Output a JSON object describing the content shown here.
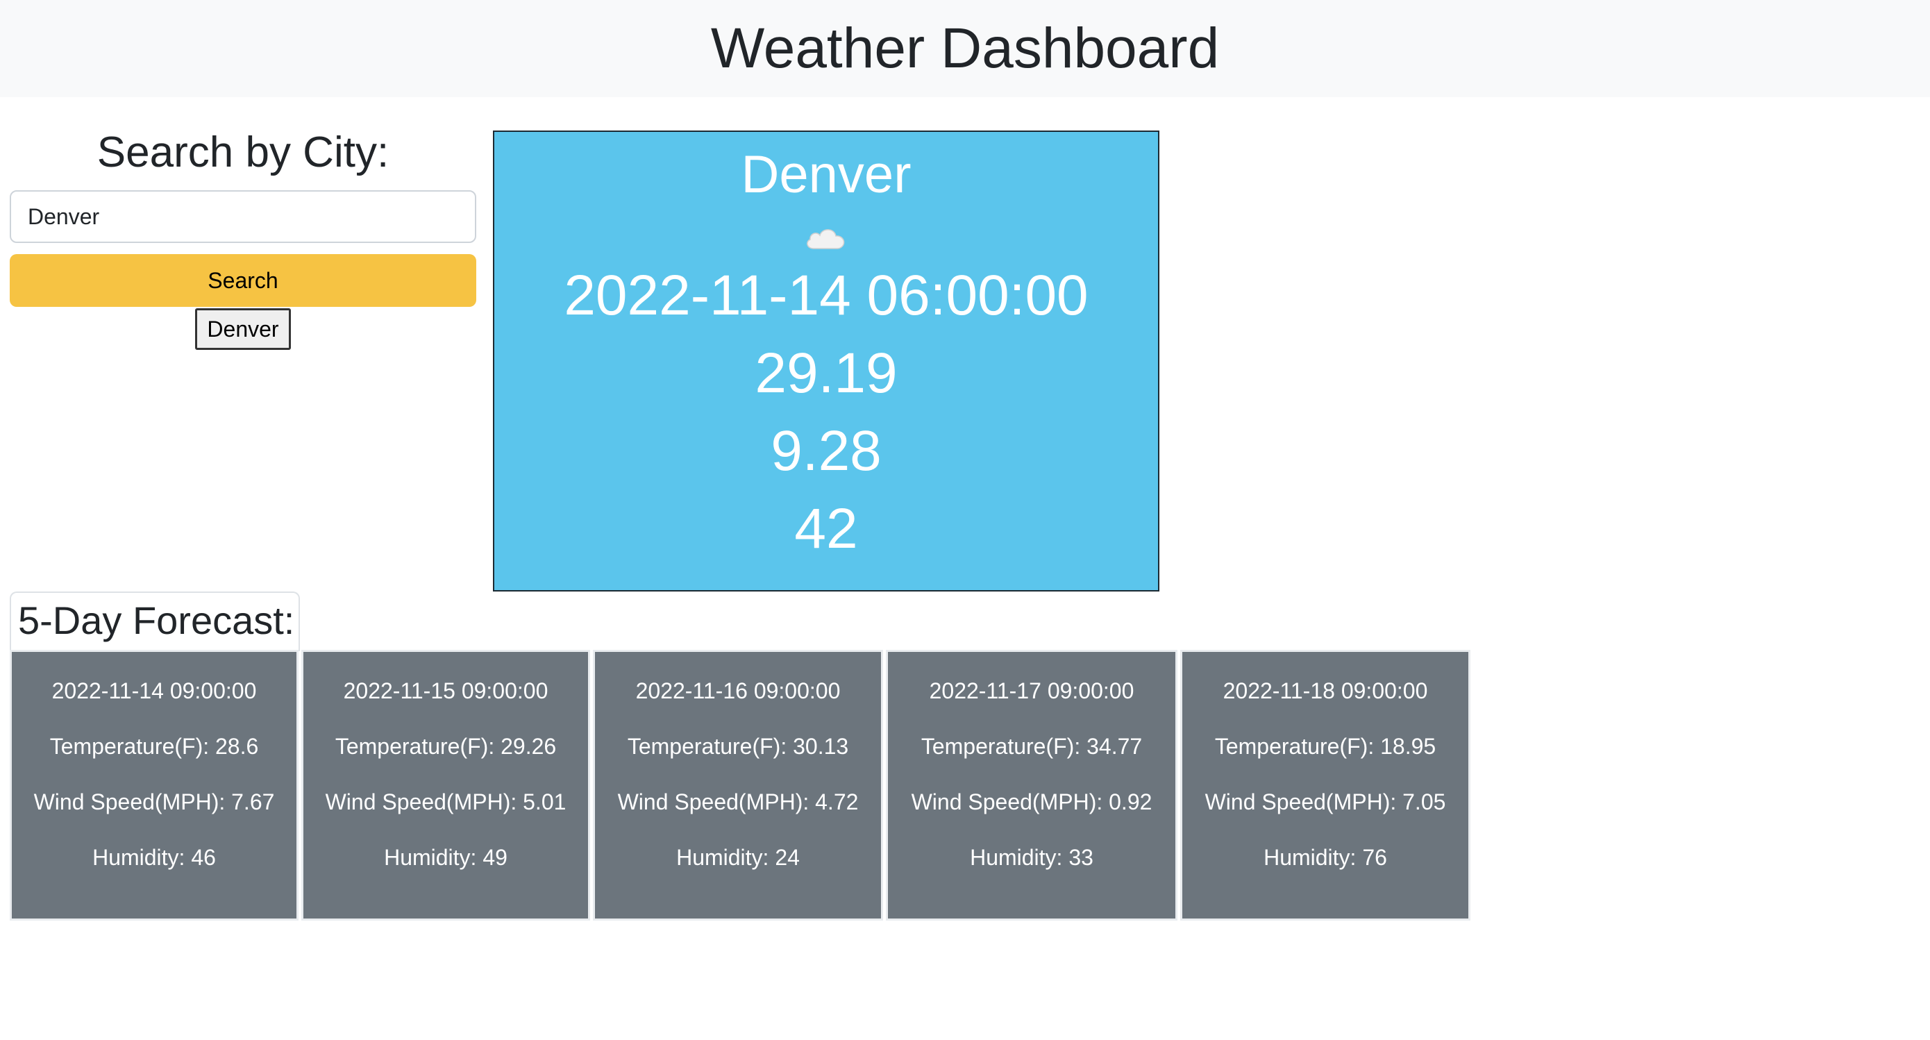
{
  "header": {
    "title": "Weather Dashboard"
  },
  "search": {
    "heading": "Search by City:",
    "input_value": "Denver",
    "button_label": "Search",
    "history": [
      "Denver"
    ]
  },
  "current": {
    "city": "Denver",
    "icon": "cloud-icon",
    "datetime": "2022-11-14 06:00:00",
    "temperature": "29.19",
    "wind": "9.28",
    "humidity": "42"
  },
  "forecast": {
    "title": "5-Day Forecast:",
    "days": [
      {
        "date": "2022-11-14 09:00:00",
        "temp": "Temperature(F): 28.6",
        "wind": "Wind Speed(MPH): 7.67",
        "humidity": "Humidity: 46"
      },
      {
        "date": "2022-11-15 09:00:00",
        "temp": "Temperature(F): 29.26",
        "wind": "Wind Speed(MPH): 5.01",
        "humidity": "Humidity: 49"
      },
      {
        "date": "2022-11-16 09:00:00",
        "temp": "Temperature(F): 30.13",
        "wind": "Wind Speed(MPH): 4.72",
        "humidity": "Humidity: 24"
      },
      {
        "date": "2022-11-17 09:00:00",
        "temp": "Temperature(F): 34.77",
        "wind": "Wind Speed(MPH): 0.92",
        "humidity": "Humidity: 33"
      },
      {
        "date": "2022-11-18 09:00:00",
        "temp": "Temperature(F): 18.95",
        "wind": "Wind Speed(MPH): 7.05",
        "humidity": "Humidity: 76"
      }
    ]
  },
  "colors": {
    "header_bg": "#f8f9fa",
    "search_button": "#f6c343",
    "current_card": "#5bc5ec",
    "forecast_card": "#6c757d"
  }
}
